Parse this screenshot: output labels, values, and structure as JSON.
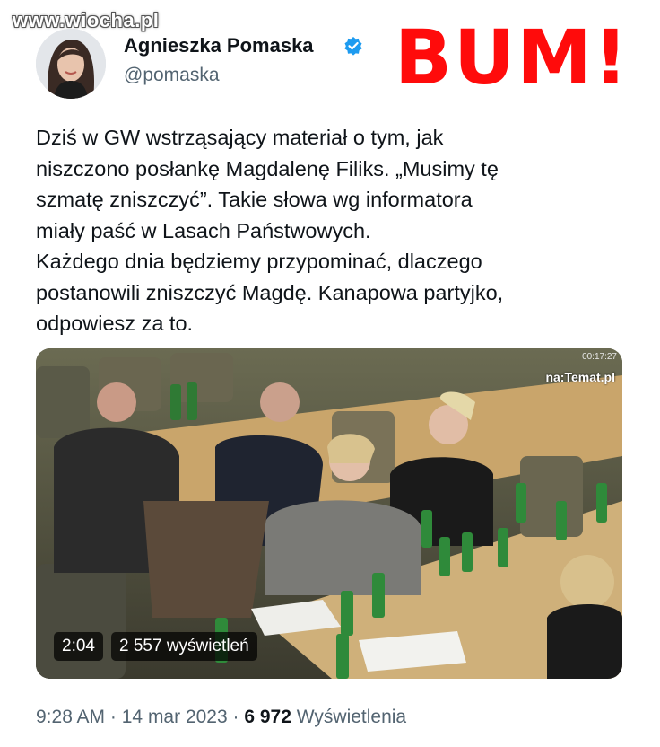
{
  "watermark": "www.wiocha.pl",
  "author": {
    "name": "Agnieszka Pomaska",
    "handle": "@pomaska",
    "verified": true
  },
  "overlay_caption": "BUM!",
  "tweet": {
    "lines": [
      "Dziś w GW wstrząsający materiał o tym, jak",
      "niszczono posłankę Magdalenę Filiks. „Musimy tę",
      "szmatę zniszczyć”. Takie słowa wg informatora",
      "miały paść w Lasach Państwowych.",
      "Każdego dnia będziemy przypominać, dlaczego",
      "postanowili zniszczyć Magdę. Kanapowa partyjko,",
      "odpowiesz za to."
    ]
  },
  "video": {
    "timestamp": "00:17:27",
    "channel_logo": "na:Temat.pl",
    "duration": "2:04",
    "views": "2 557 wyświetleń"
  },
  "meta": {
    "time": "9:28 AM",
    "separator": "·",
    "date": "14 mar 2023",
    "views_count": "6 972",
    "views_label": "Wyświetlenia"
  },
  "colors": {
    "accent_red": "#ff0b0b",
    "verified_blue": "#1d9bf0",
    "secondary_text": "#536471",
    "primary_text": "#0f1419"
  },
  "icons": [
    "verified-badge-icon"
  ]
}
